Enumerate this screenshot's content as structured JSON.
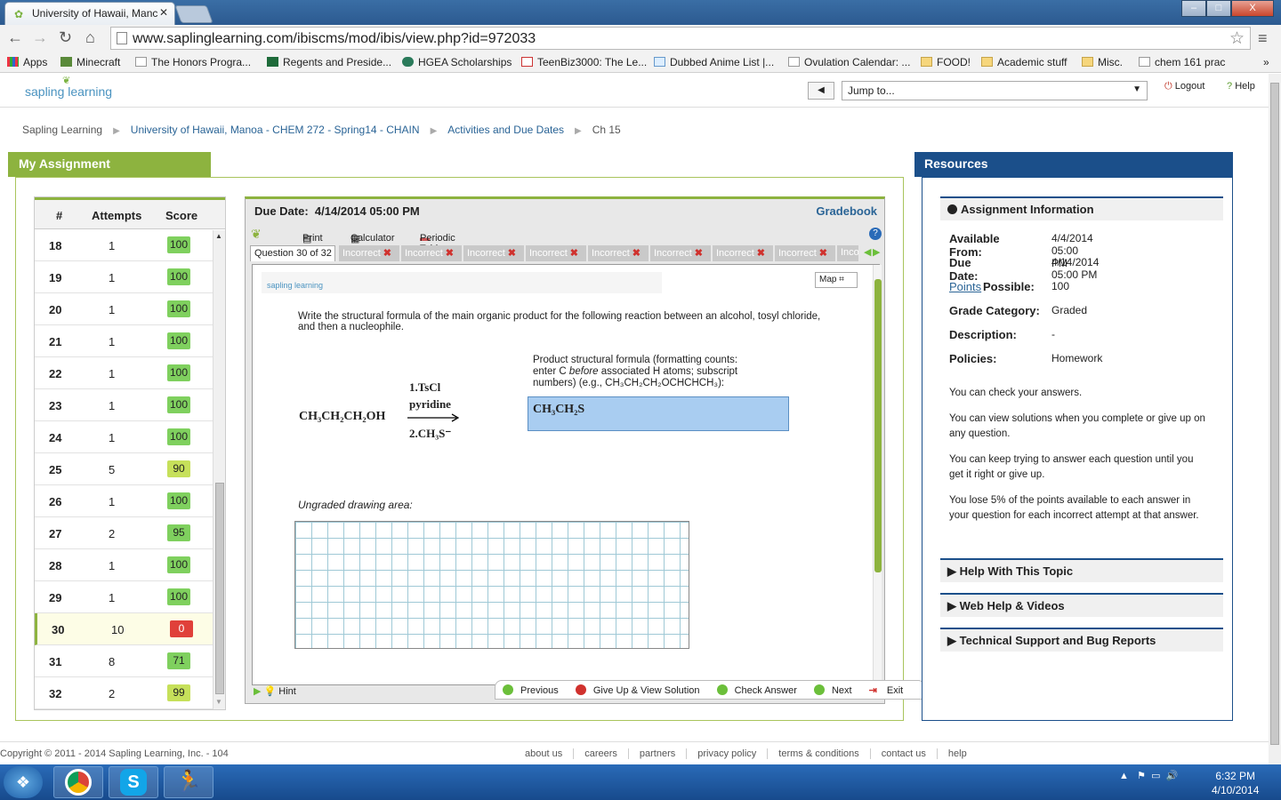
{
  "browser": {
    "tab_title": "University of Hawaii, Manc",
    "url": "www.saplinglearning.com/ibiscms/mod/ibis/view.php?id=972033",
    "window_buttons": [
      "–",
      "□",
      "X"
    ],
    "bookmarks": [
      {
        "label": "Apps",
        "icon": "apps-grid-icon"
      },
      {
        "label": "Minecraft",
        "icon": "minecraft-icon"
      },
      {
        "label": "The Honors Progra...",
        "icon": "page-icon"
      },
      {
        "label": "Regents and Preside...",
        "icon": "uh-icon"
      },
      {
        "label": "HGEA Scholarships",
        "icon": "hgea-icon"
      },
      {
        "label": "TeenBiz3000: The Le...",
        "icon": "teenbiz-icon"
      },
      {
        "label": "Dubbed Anime List |...",
        "icon": "page-icon"
      },
      {
        "label": "Ovulation Calendar: ...",
        "icon": "page-icon"
      },
      {
        "label": "FOOD!",
        "icon": "folder-icon"
      },
      {
        "label": "Academic stuff",
        "icon": "folder-icon"
      },
      {
        "label": "Misc.",
        "icon": "folder-icon"
      },
      {
        "label": "chem 161 prac",
        "icon": "page-icon"
      }
    ]
  },
  "header": {
    "logo_text": "sapling learning",
    "jump_placeholder": "Jump to...",
    "logout": "Logout",
    "help": "Help"
  },
  "breadcrumb": [
    "Sapling Learning",
    "University of Hawaii, Manoa - CHEM 272 - Spring14 - CHAIN",
    "Activities and Due Dates",
    "Ch 15"
  ],
  "my_assignment": {
    "title": "My Assignment",
    "columns": [
      "#",
      "Attempts",
      "Score"
    ],
    "rows": [
      {
        "num": "18",
        "attempts": "1",
        "score": "100",
        "status": "g"
      },
      {
        "num": "19",
        "attempts": "1",
        "score": "100",
        "status": "g"
      },
      {
        "num": "20",
        "attempts": "1",
        "score": "100",
        "status": "g"
      },
      {
        "num": "21",
        "attempts": "1",
        "score": "100",
        "status": "g"
      },
      {
        "num": "22",
        "attempts": "1",
        "score": "100",
        "status": "g"
      },
      {
        "num": "23",
        "attempts": "1",
        "score": "100",
        "status": "g"
      },
      {
        "num": "24",
        "attempts": "1",
        "score": "100",
        "status": "g"
      },
      {
        "num": "25",
        "attempts": "5",
        "score": "90",
        "status": "y"
      },
      {
        "num": "26",
        "attempts": "1",
        "score": "100",
        "status": "g"
      },
      {
        "num": "27",
        "attempts": "2",
        "score": "95",
        "status": "g"
      },
      {
        "num": "28",
        "attempts": "1",
        "score": "100",
        "status": "g"
      },
      {
        "num": "29",
        "attempts": "1",
        "score": "100",
        "status": "g"
      },
      {
        "num": "30",
        "attempts": "10",
        "score": "0",
        "status": "r",
        "active": true
      },
      {
        "num": "31",
        "attempts": "8",
        "score": "71",
        "status": "g"
      },
      {
        "num": "32",
        "attempts": "2",
        "score": "99",
        "status": "y"
      }
    ]
  },
  "question": {
    "due_label": "Due Date:",
    "due_value": "4/14/2014 05:00 PM",
    "gradebook": "Gradebook",
    "tools": [
      "Print",
      "Calculator",
      "Periodic Table"
    ],
    "current_tab": "Question 30 of 32",
    "attempt_tabs": [
      "Incorrect",
      "Incorrect",
      "Incorrect",
      "Incorrect",
      "Incorrect",
      "Incorrect",
      "Incorrect",
      "Incorrect",
      "Inco"
    ],
    "mini_logo": "sapling learning",
    "map": "Map",
    "prompt": "Write the structural formula of the main organic product for the following reaction between an alcohol, tosyl chloride, and then a nucleophile.",
    "product_label_1": "Product structural formula (formatting counts:",
    "product_label_2a": "enter C ",
    "product_label_2b": "before",
    "product_label_2c": " associated H atoms; subscript",
    "product_label_3": "numbers) (e.g., CH₃CH₂CH₂OCHCHCH₃):",
    "answer": "CH₃CH₂S",
    "reactant": "CH₃CH₂CH₂OH",
    "reagent_1": "1.TsCl",
    "reagent_2": "pyridine",
    "reagent_3": "2.CH₃S⁻",
    "drawing_label": "Ungraded drawing area:",
    "hint": "Hint",
    "nav": [
      "Previous",
      "Give Up & View Solution",
      "Check Answer",
      "Next",
      "Exit"
    ]
  },
  "resources": {
    "title": "Resources",
    "section_open": "Assignment Information",
    "info": [
      {
        "label": "Available From:",
        "value": "4/4/2014 05:00 PM"
      },
      {
        "label": "Due Date:",
        "value": "4/14/2014 05:00 PM"
      },
      {
        "label": "Possible:",
        "link": "Points",
        "value": "100"
      },
      {
        "label": "Grade Category:",
        "value": "Graded"
      },
      {
        "label": "Description:",
        "value": "-"
      },
      {
        "label": "Policies:",
        "value": "Homework"
      }
    ],
    "paragraphs": [
      "You can check your answers.",
      "You can view solutions when you complete or give up on any question.",
      "You can keep trying to answer each question until you get it right or give up.",
      "You lose 5% of the points available to each answer in your question for each incorrect attempt at that answer."
    ],
    "sections": [
      "Help With This Topic",
      "Web Help & Videos",
      "Technical Support and Bug Reports"
    ]
  },
  "footer": {
    "copyright": "Copyright © 2011 - 2014 Sapling Learning, Inc. - 104",
    "links": [
      "about us",
      "careers",
      "partners",
      "privacy policy",
      "terms & conditions",
      "contact us",
      "help"
    ]
  },
  "taskbar": {
    "time": "6:32 PM",
    "date": "4/10/2014"
  },
  "colors": {
    "green_accent": "#8db33f",
    "blue_accent": "#1b4f8a",
    "answer_fill": "#a9cdf1"
  }
}
